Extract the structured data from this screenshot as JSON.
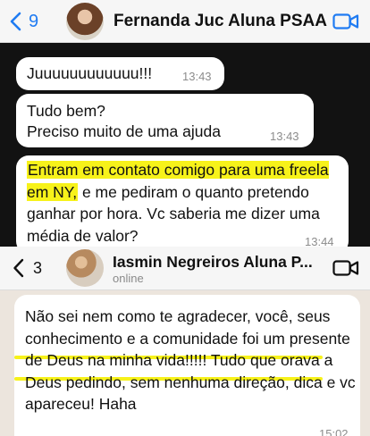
{
  "chat_top": {
    "back_count": "9",
    "contact_name": "Fernanda Juc Aluna PSAA",
    "messages": [
      {
        "lines": [
          "Juuuuuuuuuuuu!!!"
        ],
        "time": "13:43"
      },
      {
        "lines": [
          "Tudo bem?",
          "Preciso muito de uma ajuda"
        ],
        "time": "13:43"
      },
      {
        "highlighted": "Entram em contato comigo para uma freela em NY,",
        "text": " e me pediram o quanto pretendo ganhar por hora. Vc saberia me dizer uma média de valor?",
        "time": "13:44"
      }
    ]
  },
  "chat_bottom": {
    "back_count": "3",
    "contact_name": "Iasmin Negreiros Aluna P...",
    "status": "online",
    "message": {
      "part1": "Não sei nem como te agradecer, você, ",
      "part2": "seus conhecimento e a comunidade foi um presente de Deus na minha vida!!!!!",
      "part3": " Tudo que orava a Deus pedindo, sem nenhuma direção, dica e vc apareceu! Haha",
      "time": "15:02"
    }
  },
  "colors": {
    "accent_blue": "#1f7bf2",
    "highlight": "#f7f21a",
    "dark_bg": "#121212"
  },
  "icons": [
    "chevron-left-icon",
    "video-call-icon"
  ]
}
